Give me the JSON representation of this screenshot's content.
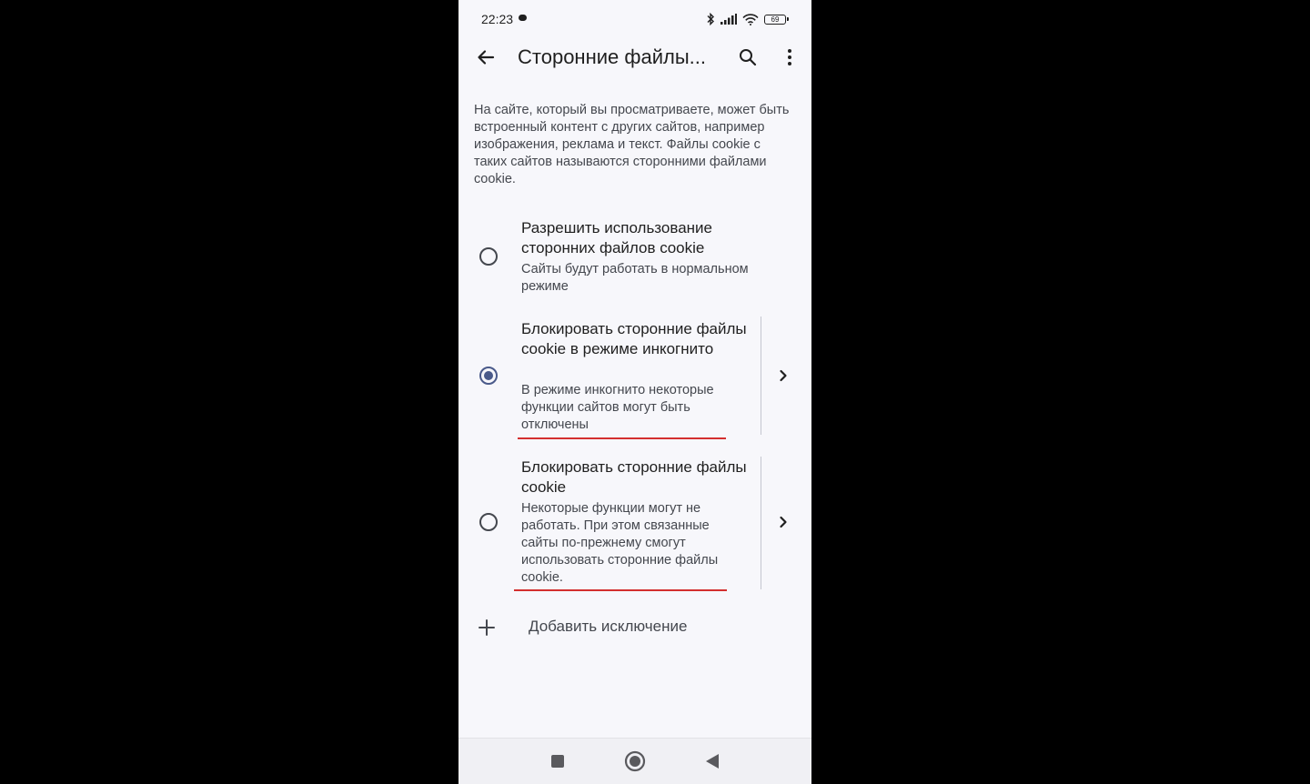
{
  "status_bar": {
    "time": "22:23",
    "battery": "69"
  },
  "app_bar": {
    "title": "Сторонние файлы..."
  },
  "description": "На сайте, который вы просматриваете, может быть встроенный контент с других сайтов, например изображения, реклама и текст. Файлы cookie с таких сайтов называются сторонними файлами cookie.",
  "options": [
    {
      "title": "Разрешить использование сторонних файлов cookie",
      "subtitle": "Сайты будут работать в нормальном режиме",
      "selected": false
    },
    {
      "title": "Блокировать сторонние файлы cookie в режиме инкогнито",
      "subtitle": "В режиме инкогнито некоторые функции сайтов могут быть отключены",
      "selected": true
    },
    {
      "title": "Блокировать сторонние файлы cookie",
      "subtitle": "Некоторые функции могут не работать. При этом связанные сайты по-прежнему смогут использовать сторонние файлы cookie.",
      "selected": false
    }
  ],
  "add_exception": {
    "label": "Добавить исключение"
  },
  "colors": {
    "accent": "#4a5a8a",
    "annotation": "#d32f2f",
    "background": "#f7f7fb"
  },
  "icons": {
    "back": "arrow-back-icon",
    "search": "search-icon",
    "more": "more-vert-icon",
    "chevron": "chevron-right-icon",
    "add": "plus-icon"
  }
}
